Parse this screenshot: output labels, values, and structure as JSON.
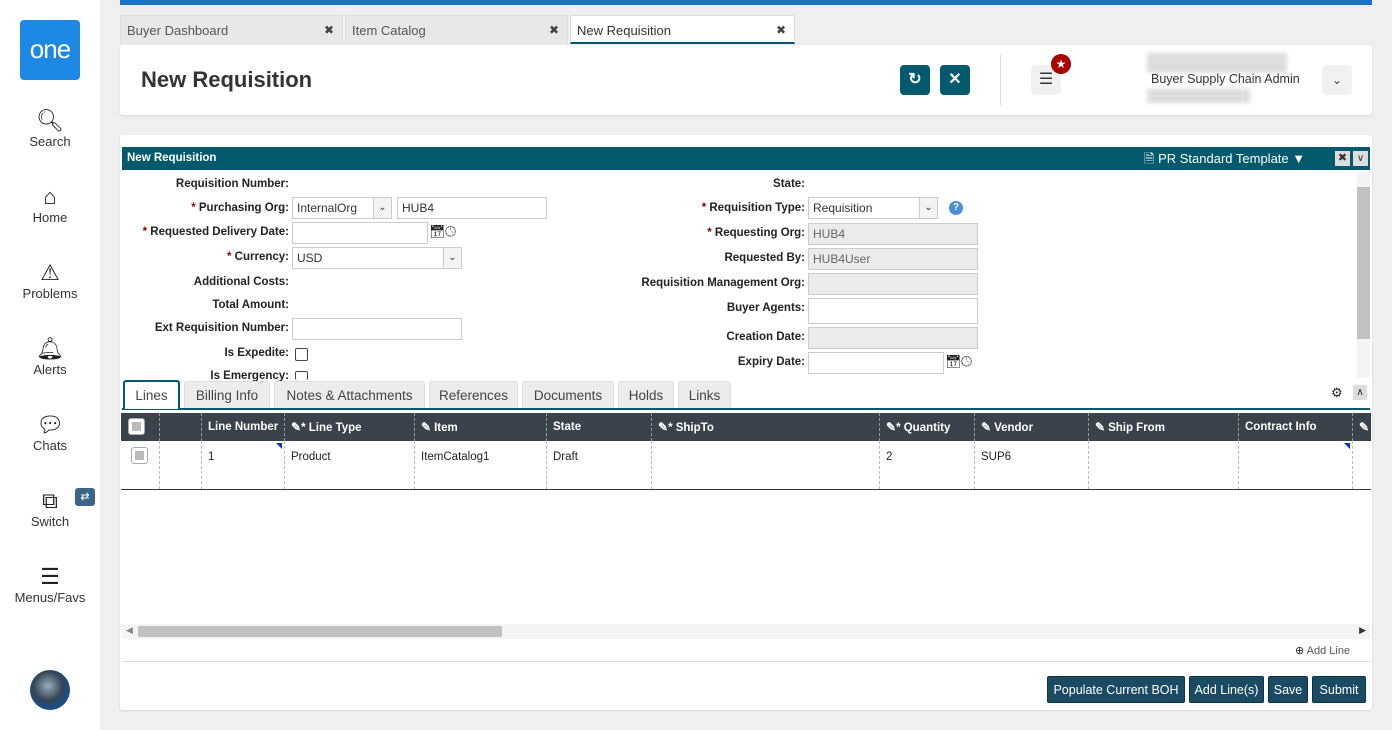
{
  "sidebar": {
    "logo": "one",
    "items": [
      {
        "label": "Search"
      },
      {
        "label": "Home"
      },
      {
        "label": "Problems"
      },
      {
        "label": "Alerts"
      },
      {
        "label": "Chats"
      },
      {
        "label": "Switch"
      },
      {
        "label": "Menus/Favs"
      }
    ]
  },
  "tabs": [
    {
      "label": "Buyer Dashboard"
    },
    {
      "label": "Item Catalog"
    },
    {
      "label": "New Requisition"
    }
  ],
  "header": {
    "title": "New Requisition",
    "role": "Buyer Supply Chain Admin"
  },
  "panel": {
    "title": "New Requisition",
    "template": "PR Standard Template"
  },
  "form": {
    "left": {
      "req_number": "Requisition Number:",
      "purchasing_org": "Purchasing Org:",
      "purchasing_org_type": "InternalOrg",
      "purchasing_org_value": "HUB4",
      "delivery_date": "Requested Delivery Date:",
      "currency": "Currency:",
      "currency_value": "USD",
      "additional_costs": "Additional Costs:",
      "total_amount": "Total Amount:",
      "ext_req_number": "Ext Requisition Number:",
      "is_expedite": "Is Expedite:",
      "is_emergency": "Is Emergency:"
    },
    "right": {
      "state": "State:",
      "req_type": "Requisition Type:",
      "req_type_value": "Requisition",
      "requesting_org": "Requesting Org:",
      "requesting_org_value": "HUB4",
      "requested_by": "Requested By:",
      "requested_by_value": "HUB4User",
      "mgmt_org": "Requisition Management Org:",
      "buyer_agents": "Buyer Agents:",
      "creation_date": "Creation Date:",
      "expiry_date": "Expiry Date:"
    },
    "required_mark": "*"
  },
  "line_tabs": [
    "Lines",
    "Billing Info",
    "Notes & Attachments",
    "References",
    "Documents",
    "Holds",
    "Links"
  ],
  "grid": {
    "columns": [
      "Line Number",
      "Line Type",
      "Item",
      "State",
      "ShipTo",
      "Quantity",
      "Vendor",
      "Ship From",
      "Contract Info"
    ],
    "rows": [
      {
        "line_number": "1",
        "line_type": "Product",
        "item": "ItemCatalog1",
        "state": "Draft",
        "shipto": "",
        "quantity": "2",
        "vendor": "SUP6",
        "ship_from": "",
        "contract_info": ""
      }
    ]
  },
  "add_line": "Add Line",
  "buttons": {
    "populate": "Populate Current BOH",
    "add_lines": "Add Line(s)",
    "save": "Save",
    "submit": "Submit"
  }
}
